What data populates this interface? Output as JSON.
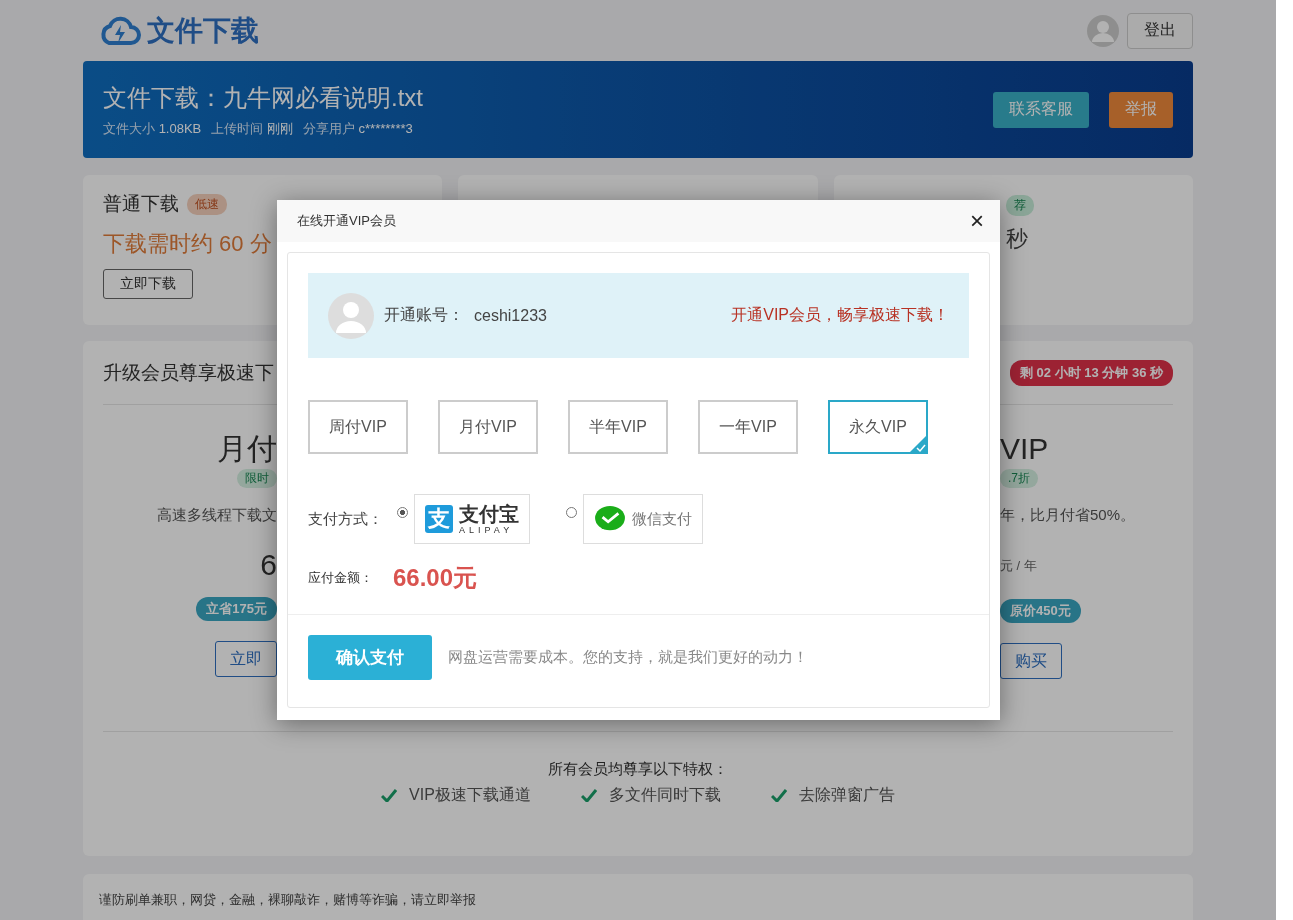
{
  "header": {
    "logo": "文件下载",
    "logout": "登出"
  },
  "banner": {
    "title": "文件下载：九牛网必看说明.txt",
    "meta": [
      {
        "label": "文件大小",
        "value": "1.08KB"
      },
      {
        "label": "上传时间",
        "value": "刚刚"
      },
      {
        "label": "分享用户",
        "value": "c********3"
      }
    ],
    "buttons": [
      {
        "label": "联系客服",
        "kind": "contact"
      },
      {
        "label": "举报",
        "kind": "report"
      }
    ]
  },
  "download_cards": [
    {
      "title": "普通下载",
      "badge": "低速",
      "info": "下载需时约 60 分",
      "button": "立即下载"
    },
    {
      "badge": "荐",
      "info": "秒"
    }
  ],
  "upgrade": {
    "title": "升级会员尊享极速下",
    "countdown": "剩 02 小时 13 分钟 36 秒",
    "plans": [
      {
        "name": "月付",
        "tag": "限时",
        "desc": "高速多线程下载文",
        "price": "6",
        "saving": "立省175元",
        "button": "立即"
      },
      {
        "name": "VIP",
        "tag": ".7折",
        "desc": "年，比月付省50%。",
        "unit": "元 / 年",
        "saving": "原价450元",
        "button": "购买"
      }
    ],
    "privileges_title": "所有会员均尊享以下特权：",
    "privileges": [
      "VIP极速下载通道",
      "多文件同时下载",
      "去除弹窗广告"
    ]
  },
  "notice": "谨防刷单兼职，网贷，金融，裸聊敲诈，赌博等诈骗，请立即举报",
  "modal": {
    "title": "在线开通VIP会员",
    "close": "×",
    "account_label": "开通账号：",
    "account": "ceshi1233",
    "slogan": "开通VIP会员，畅享极速下载！",
    "plans": [
      {
        "label": "周付VIP",
        "selected": false
      },
      {
        "label": "月付VIP",
        "selected": false
      },
      {
        "label": "半年VIP",
        "selected": false
      },
      {
        "label": "一年VIP",
        "selected": false
      },
      {
        "label": "永久VIP",
        "selected": true
      }
    ],
    "payment_label": "支付方式：",
    "methods": [
      {
        "kind": "alipay",
        "selected": true,
        "mark": "支",
        "label": "支付宝",
        "sub": "ALIPAY"
      },
      {
        "kind": "wechat",
        "selected": false,
        "label": "微信支付"
      }
    ],
    "amount_label": "应付金额：",
    "amount": "66.00元",
    "confirm": "确认支付",
    "note": "网盘运营需要成本。您的支持，就是我们更好的动力！"
  }
}
